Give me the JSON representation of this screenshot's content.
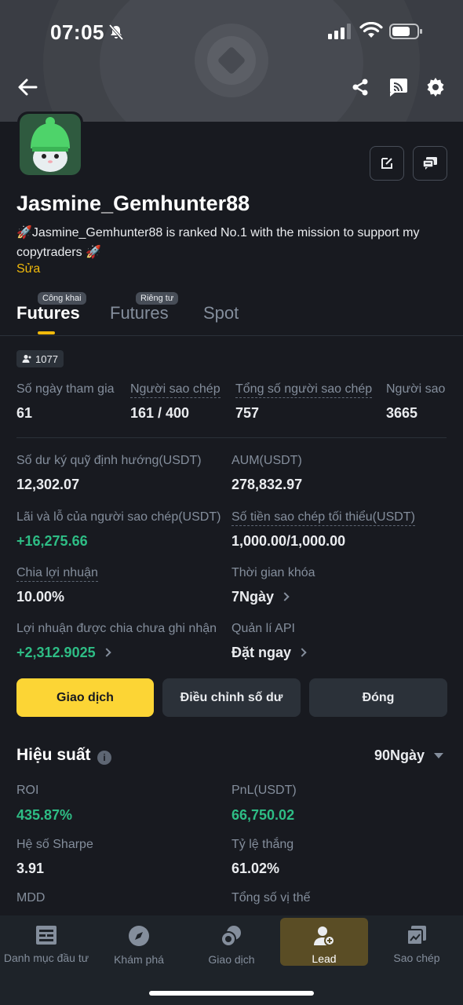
{
  "status_bar": {
    "time": "07:05"
  },
  "profile": {
    "username": "Jasmine_Gemhunter88",
    "bio": "🚀Jasmine_Gemhunter88 is ranked No.1 with the mission to support my copytraders 🚀",
    "edit_label": "Sửa"
  },
  "tabs": [
    {
      "label": "Futures",
      "badge": "Công khai",
      "active": true
    },
    {
      "label": "Futures",
      "badge": "Riêng tư",
      "active": false
    },
    {
      "label": "Spot",
      "badge": "",
      "active": false
    }
  ],
  "followers_count": "1077",
  "stats": [
    {
      "label": "Số ngày tham gia",
      "value": "61"
    },
    {
      "label": "Người sao chép",
      "value": "161 / 400"
    },
    {
      "label": "Tổng số người sao chép",
      "value": "757"
    },
    {
      "label": "Người sao",
      "value": "3665"
    }
  ],
  "details": {
    "deposit_label": "Số dư ký quỹ định hướng(USDT)",
    "deposit_value": "12,302.07",
    "aum_label": "AUM(USDT)",
    "aum_value": "278,832.97",
    "pnl_label": "Lãi và lỗ của người sao chép(USDT)",
    "pnl_value": "+16,275.66",
    "min_copy_label": "Số tiền sao chép tối thiểu(USDT)",
    "min_copy_value": "1,000.00/1,000.00",
    "profit_share_label": "Chia lợi nhuận",
    "profit_share_value": "10.00%",
    "lock_label": "Thời gian khóa",
    "lock_value": "7Ngày",
    "unrealized_label": "Lợi nhuận được chia chưa ghi nhận",
    "unrealized_value": "+2,312.9025",
    "api_label": "Quản lí API",
    "api_value": "Đặt ngay"
  },
  "actions": {
    "trade": "Giao dịch",
    "adjust": "Điều chỉnh số dư",
    "close": "Đóng"
  },
  "performance": {
    "title": "Hiệu suất",
    "period": "90Ngày",
    "roi_label": "ROI",
    "roi_value": "435.87%",
    "pnl_label": "PnL(USDT)",
    "pnl_value": "66,750.02",
    "sharpe_label": "Hệ số Sharpe",
    "sharpe_value": "3.91",
    "winrate_label": "Tỷ lệ thắng",
    "winrate_value": "61.02%",
    "mdd_label": "MDD",
    "positions_label": "Tổng số vị thế"
  },
  "bottom_nav": [
    {
      "label": "Danh mục đầu tư",
      "icon": "portfolio-icon"
    },
    {
      "label": "Khám phá",
      "icon": "compass-icon"
    },
    {
      "label": "Giao dịch",
      "icon": "trade-icon"
    },
    {
      "label": "Lead",
      "icon": "lead-icon",
      "active": true
    },
    {
      "label": "Sao chép",
      "icon": "copy-trade-icon"
    }
  ],
  "colors": {
    "accent": "#fcd535",
    "positive": "#2ebd85",
    "background": "#181a20"
  }
}
